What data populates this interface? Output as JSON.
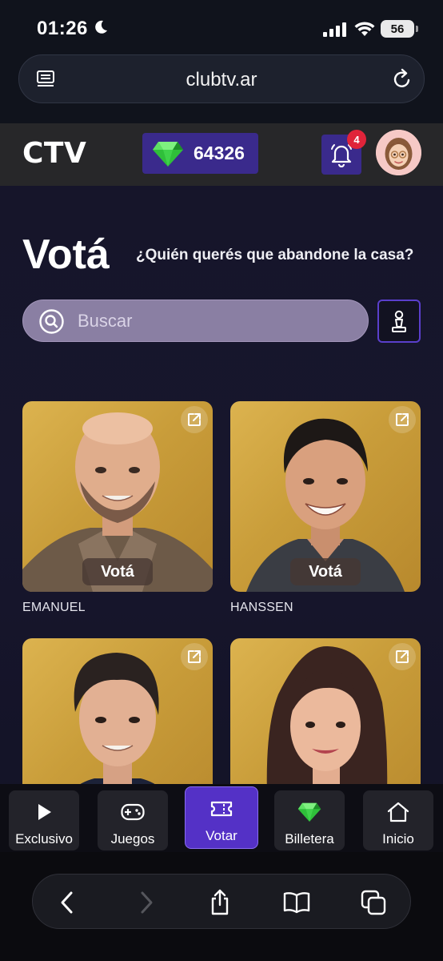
{
  "status_bar": {
    "time": "01:26",
    "battery": "56"
  },
  "browser": {
    "url": "clubtv.ar"
  },
  "header": {
    "logo": "CTV",
    "coins": "64326",
    "notifications": "4"
  },
  "page": {
    "title": "Votá",
    "subtitle": "¿Quién querés que abandone la casa?",
    "search_placeholder": "Buscar"
  },
  "candidates": [
    {
      "name": "EMANUEL",
      "vote_label": "Votá"
    },
    {
      "name": "HANSSEN",
      "vote_label": "Votá"
    },
    {
      "name": "",
      "vote_label": ""
    },
    {
      "name": "",
      "vote_label": ""
    }
  ],
  "bottom_nav": [
    {
      "label": "Exclusivo",
      "icon": "play-icon"
    },
    {
      "label": "Juegos",
      "icon": "gamepad-icon"
    },
    {
      "label": "Votar",
      "icon": "ticket-icon",
      "active": true
    },
    {
      "label": "Billetera",
      "icon": "gem-icon"
    },
    {
      "label": "Inicio",
      "icon": "home-icon"
    }
  ],
  "colors": {
    "accent": "#5431c6",
    "card_gold": "#d4a843",
    "badge_red": "#e0243a",
    "gem_green": "#2fbf3a"
  }
}
